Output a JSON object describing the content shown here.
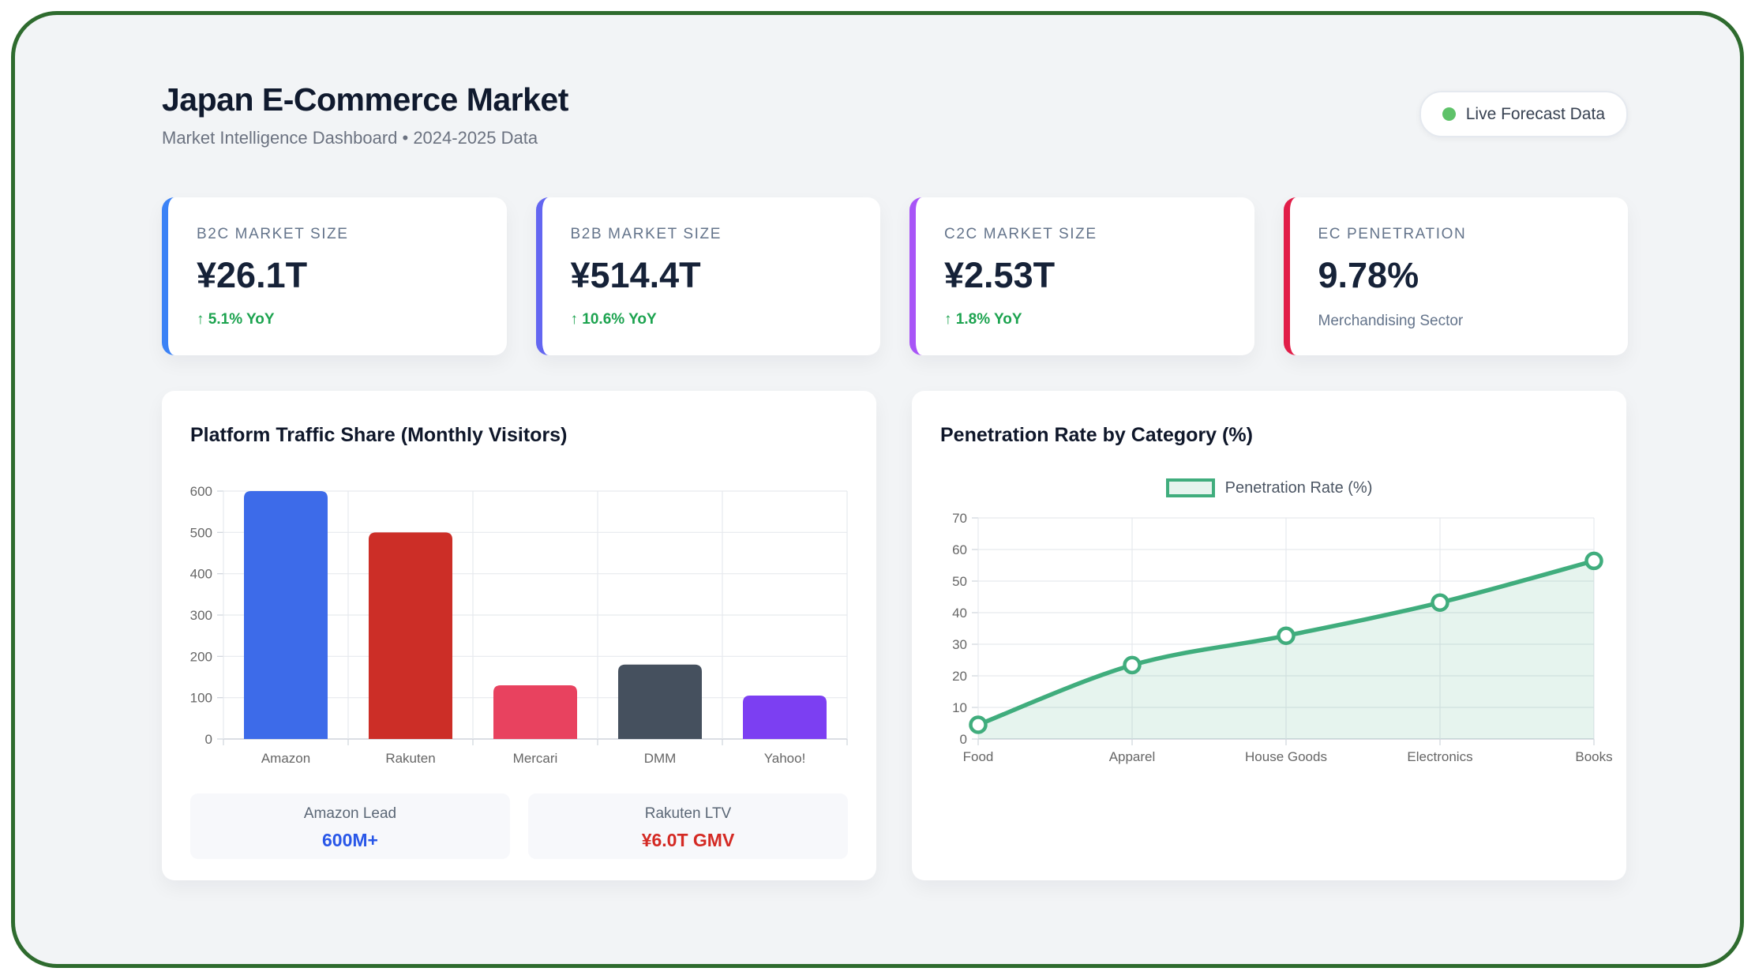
{
  "header": {
    "title": "Japan E-Commerce Market",
    "subtitle": "Market Intelligence Dashboard • 2024-2025 Data",
    "badge": {
      "label": "Live Forecast Data",
      "dot_color": "#5ec269"
    }
  },
  "kpis": [
    {
      "label": "B2C MARKET SIZE",
      "value": "¥26.1T",
      "delta": "↑ 5.1% YoY",
      "accent": "#3b82f6"
    },
    {
      "label": "B2B MARKET SIZE",
      "value": "¥514.4T",
      "delta": "↑ 10.6% YoY",
      "accent": "#6366f1"
    },
    {
      "label": "C2C MARKET SIZE",
      "value": "¥2.53T",
      "delta": "↑ 1.8% YoY",
      "accent": "#a855f7"
    },
    {
      "label": "EC PENETRATION",
      "value": "9.78%",
      "note": "Merchandising Sector",
      "accent": "#e11d48"
    }
  ],
  "chart_data": [
    {
      "type": "bar",
      "title": "Platform Traffic Share (Monthly Visitors)",
      "categories": [
        "Amazon",
        "Rakuten",
        "Mercari",
        "DMM",
        "Yahoo!"
      ],
      "values": [
        600,
        500,
        130,
        180,
        105
      ],
      "bar_colors": [
        "#3d6be9",
        "#cc2e27",
        "#e8425f",
        "#45505e",
        "#7c3ff2"
      ],
      "xlabel": "",
      "ylabel": "",
      "ylim": [
        0,
        600
      ],
      "ytick_step": 100,
      "grid": true,
      "legend_position": "none",
      "tick_color": "#666666",
      "grid_color": "#e7e9ee",
      "axis_color": "#cfd4db"
    },
    {
      "type": "line",
      "title": "Penetration Rate by Category (%)",
      "legend": "Penetration Rate (%)",
      "categories": [
        "Food",
        "Apparel",
        "House Goods",
        "Electronics",
        "Books"
      ],
      "values": [
        4.5,
        23.4,
        32.7,
        43.2,
        56.4
      ],
      "line_color": "#40ad7d",
      "fill_color": "rgba(64,173,125,0.13)",
      "point_fill": "#ffffff",
      "xlabel": "",
      "ylabel": "",
      "ylim": [
        0,
        70
      ],
      "ytick_step": 10,
      "grid": true,
      "legend_position": "top-center",
      "tick_color": "#666666",
      "grid_color": "#e7e9ee",
      "axis_color": "#cfd4db"
    }
  ],
  "footer_stats": [
    {
      "label": "Amazon Lead",
      "value": "600M+",
      "color": "#2957e8"
    },
    {
      "label": "Rakuten LTV",
      "value": "¥6.0T GMV",
      "color": "#d42a24"
    }
  ]
}
